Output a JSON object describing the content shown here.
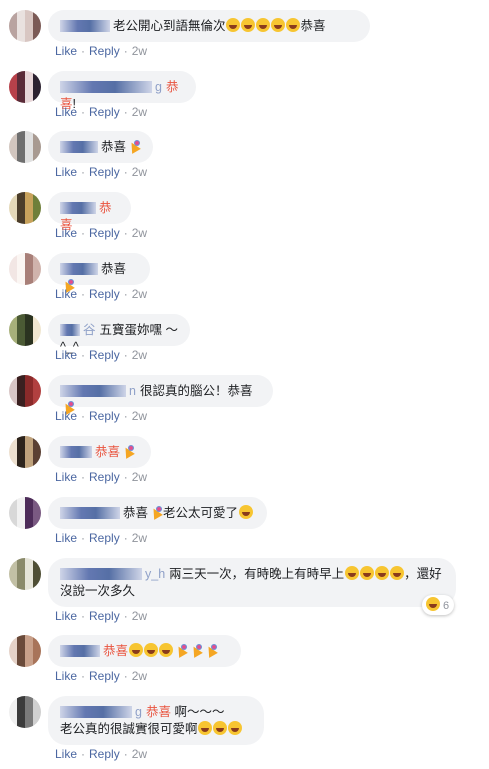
{
  "actions": {
    "like": "Like",
    "reply": "Reply",
    "sep": "·",
    "time": "2w"
  },
  "comments": [
    {
      "name_suffix": "",
      "text_pre": "老公開心到語無倫次",
      "text_hl": "",
      "text_post": "",
      "text2": "",
      "emoji": [
        "laugh",
        "laugh",
        "laugh",
        "laugh",
        "laugh"
      ],
      "emoji_after": "恭喜"
    },
    {
      "name_suffix": "g",
      "text_pre": "",
      "text_hl": "恭喜",
      "text_post": "!",
      "text2": "",
      "emoji": [],
      "emoji_after": ""
    },
    {
      "name_suffix": "",
      "text_pre": "恭喜",
      "text_hl": "",
      "text_post": "",
      "text2": "",
      "emoji": [
        "party"
      ],
      "emoji_after": ""
    },
    {
      "name_suffix": "",
      "text_pre": "",
      "text_hl": "恭喜",
      "text_post": "",
      "text2": "",
      "emoji": [],
      "emoji_after": ""
    },
    {
      "name_suffix": "",
      "text_pre": "恭喜",
      "text_hl": "",
      "text_post": "",
      "text2": "",
      "emoji": [
        "party"
      ],
      "emoji_after": ""
    },
    {
      "name_suffix": "谷",
      "text_pre": "五寶蛋妳嘿 ～^_^",
      "text_hl": "",
      "text_post": "",
      "text2": "",
      "emoji": [],
      "emoji_after": ""
    },
    {
      "name_suffix": "n",
      "text_pre": "很認真的腦公！恭喜",
      "text_hl": "",
      "text_post": "",
      "text2": "",
      "emoji": [
        "party"
      ],
      "emoji_after": ""
    },
    {
      "name_suffix": "",
      "text_pre": "",
      "text_hl": "恭喜",
      "text_post": "",
      "text2": "",
      "emoji": [
        "party"
      ],
      "emoji_after": ""
    },
    {
      "name_suffix": "",
      "text_pre": "恭喜",
      "text_hl": "",
      "text_post": "",
      "text2": "",
      "emoji": [
        "party"
      ],
      "emoji_after": "老公太可愛了",
      "emoji_end": [
        "laugh"
      ]
    },
    {
      "name_suffix": "y_h",
      "text_pre": "兩三天一次，有時晚上有時早上",
      "text_hl": "",
      "text_post": "",
      "text2": "沒說一次多久",
      "emoji": [
        "laugh",
        "laugh",
        "laugh",
        "laugh"
      ],
      "emoji_after": "，還好",
      "reaction": "6"
    },
    {
      "name_suffix": "",
      "text_pre": "",
      "text_hl": "恭喜",
      "text_post": "",
      "text2": "",
      "emoji": [
        "laugh",
        "laugh",
        "laugh",
        "party",
        "party",
        "party"
      ],
      "emoji_after": ""
    },
    {
      "name_suffix": "g",
      "text_pre": "",
      "text_hl": "恭喜",
      "text_post": " 啊～～～",
      "text2": "老公真的很誠實很可愛啊",
      "emoji": [],
      "emoji_after": "",
      "emoji_line2": [
        "laugh",
        "laugh",
        "laugh"
      ]
    }
  ]
}
